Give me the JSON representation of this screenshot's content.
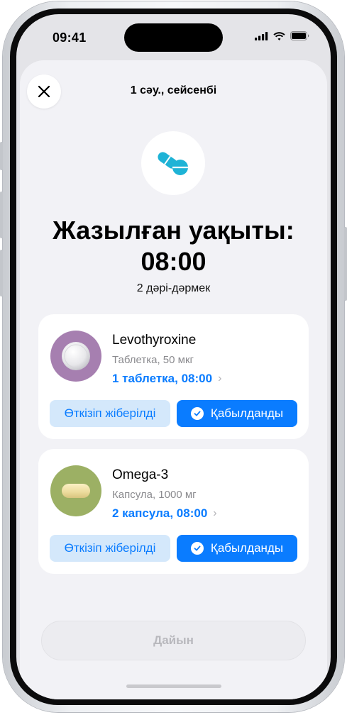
{
  "status_bar": {
    "time": "09:41"
  },
  "sheet": {
    "title": "1 сәу., сейсенбі",
    "heading_line1": "Жазылған уақыты:",
    "heading_line2": "08:00",
    "subheading": "2 дәрі-дәрмек"
  },
  "medications": [
    {
      "name": "Levothyroxine",
      "detail": "Таблетка, 50 мкг",
      "dose": "1 таблетка, 08:00",
      "icon": "round-tablet-icon",
      "icon_bg": "#a67fb0",
      "skip_label": "Өткізіп жіберілді",
      "taken_label": "Қабылданды"
    },
    {
      "name": "Omega-3",
      "detail": "Капсула, 1000 мг",
      "dose": "2 капсула, 08:00",
      "icon": "capsule-icon",
      "icon_bg": "#9cb064",
      "skip_label": "Өткізіп жіберілді",
      "taken_label": "Қабылданды"
    }
  ],
  "footer": {
    "done_label": "Дайын"
  },
  "colors": {
    "accent": "#0a7cff",
    "skip_bg": "#d4e8fb",
    "sheet_bg": "#f2f2f6",
    "pill_icon": "#1eb3d6"
  }
}
